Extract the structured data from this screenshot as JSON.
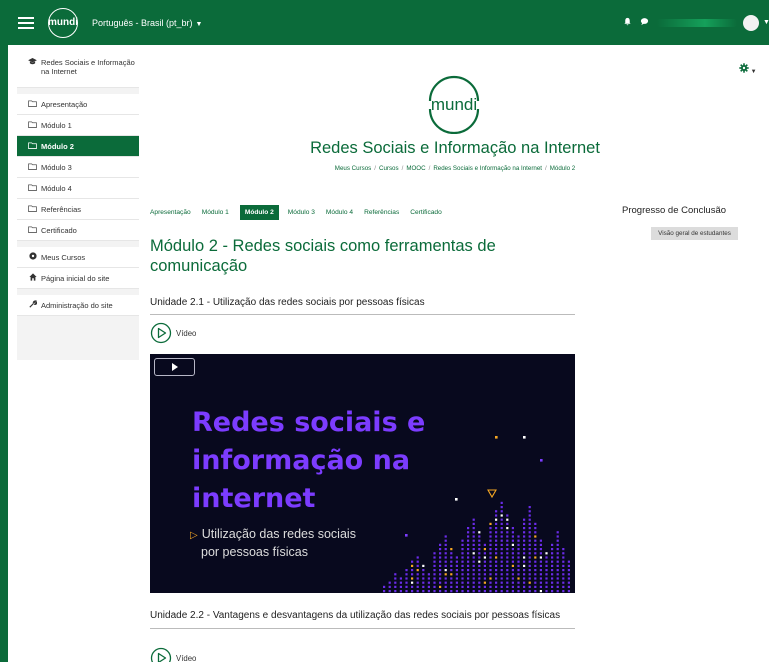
{
  "navbar": {
    "logo_text": "mundi",
    "language": "Português - Brasil (pt_br)",
    "menu_icon": "hamburger-icon",
    "notifications_icon": "bell-icon",
    "messages_icon": "chat-icon"
  },
  "sidebar": {
    "course": "Redes Sociais e Informação na Internet",
    "items": [
      {
        "label": "Apresentação",
        "icon": "folder-icon"
      },
      {
        "label": "Módulo 1",
        "icon": "folder-icon"
      },
      {
        "label": "Módulo 2",
        "icon": "folder-icon",
        "active": true
      },
      {
        "label": "Módulo 3",
        "icon": "folder-icon"
      },
      {
        "label": "Módulo 4",
        "icon": "folder-icon"
      },
      {
        "label": "Referências",
        "icon": "folder-icon"
      },
      {
        "label": "Certificado",
        "icon": "folder-icon"
      }
    ],
    "links": [
      {
        "label": "Meus Cursos",
        "icon": "courses-icon"
      },
      {
        "label": "Página inicial do site",
        "icon": "home-icon"
      }
    ],
    "admin": {
      "label": "Administração do site",
      "icon": "wrench-icon"
    }
  },
  "header": {
    "logo_text": "mundi",
    "course_title": "Redes Sociais e Informação na Internet",
    "breadcrumb": [
      "Meus Cursos",
      "Cursos",
      "MOOC",
      "Redes Sociais e Informação na Internet",
      "Módulo 2"
    ]
  },
  "tabs": [
    "Apresentação",
    "Módulo 1",
    "Módulo 2",
    "Módulo 3",
    "Módulo 4",
    "Referências",
    "Certificado"
  ],
  "active_tab": "Módulo 2",
  "main": {
    "module_title": "Módulo 2 - Redes sociais como ferramentas de comunicação",
    "unit1_title": "Unidade 2.1 - Utilização das redes sociais por pessoas físicas",
    "unit2_title": "Unidade 2.2 - Vantagens e desvantagens da utilização das redes sociais por pessoas físicas",
    "video_label": "Vídeo",
    "video": {
      "headline": "Redes sociais e informação na internet",
      "subtitle_line1": "Utilização das redes sociais",
      "subtitle_line2": "por pessoas físicas"
    }
  },
  "right_panel": {
    "progress_title": "Progresso de Conclusão",
    "overview_button": "Visão geral de estudantes"
  },
  "colors": {
    "brand_green": "#0b6b3a",
    "video_purple": "#7c3cff",
    "video_bg": "#08091e",
    "accent_orange": "#f5a623"
  }
}
